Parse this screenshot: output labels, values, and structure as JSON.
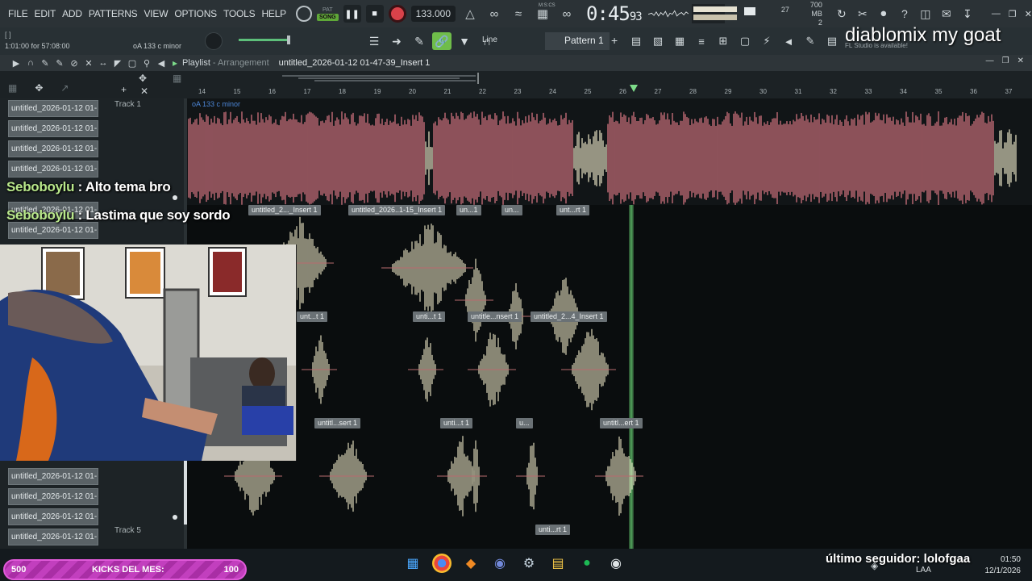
{
  "menu": [
    "FILE",
    "EDIT",
    "ADD",
    "PATTERNS",
    "VIEW",
    "OPTIONS",
    "TOOLS",
    "HELP"
  ],
  "transport": {
    "pat_label": "PAT",
    "song_label": "SONG",
    "tempo": "133.000",
    "time_main": "0:45",
    "time_sub": "93",
    "time_unit": "M:S:CS",
    "cpu_value": "27",
    "poly_value": "2",
    "memory": "700 MB"
  },
  "hint": {
    "brackets": "[ ]",
    "time": "1:01:00 for 57:08:00",
    "key": "oA 133 c minor"
  },
  "toolbar": {
    "snap_mode": "Line",
    "pattern": "Pattern 1",
    "news": "FL Studio is available!"
  },
  "stream_title": "diablomix my goat",
  "playlist": {
    "title": "Playlist",
    "title_sep": " - ",
    "view": "Arrangement",
    "file": "untitled_2026-01-12 01-47-39_Insert 1",
    "track1_clip_label": "oA 133 c minor"
  },
  "ruler": [
    "14",
    "15",
    "16",
    "17",
    "18",
    "19",
    "20",
    "21",
    "22",
    "23",
    "24",
    "25",
    "26",
    "27",
    "28",
    "29",
    "30",
    "31",
    "32",
    "33",
    "34",
    "35",
    "36",
    "37"
  ],
  "pattern_list": [
    "untitled_2026-01-12 01-...",
    "untitled_2026-01-12 01-...",
    "untitled_2026-01-12 01-...",
    "untitled_2026-01-12 01-...",
    "untitled_2026-01-12 01-...",
    "untitled_2026-01-12 01-...",
    "untitled_2026-01-12 01-...",
    "untitled_2026-01-12 01-...",
    "untitled_2026-01-12 01-...",
    "untitled_2026-01-12 01-..."
  ],
  "tracks": {
    "track1": "Track 1",
    "track5": "Track 5"
  },
  "clips": {
    "row2": [
      "untitled_2..._Insert 1",
      "untitled_2026..1-15_Insert 1",
      "un...1",
      "un...",
      "unt...rt 1"
    ],
    "row3": [
      "unt...t 1",
      "unti...t 1",
      "untitle...nsert 1",
      "untitled_2...4_Insert 1"
    ],
    "row4": [
      "untitl...sert 1",
      "unti...t 1",
      "u...",
      "untitl...ert 1"
    ],
    "row5": [
      "unti...rt 1"
    ]
  },
  "chat": [
    {
      "user": "Seboboylu",
      "sep": " : ",
      "text": "Alto tema bro"
    },
    {
      "user": "Seboboylu",
      "sep": " : ",
      "text": "Lastima que soy sordo"
    }
  ],
  "kicks": {
    "left": "500",
    "label": "KICKS DEL MES:",
    "right": "100"
  },
  "follower": "último seguidor: lolofgaa",
  "tray": {
    "lang": "LAA",
    "time": "01:50",
    "date": "12/1/2026"
  },
  "colors": {
    "accent": "#6fbd4a",
    "wave_red": "#e07a86",
    "wave_cream": "#eeeac9",
    "kicks": "#c23fbe"
  }
}
